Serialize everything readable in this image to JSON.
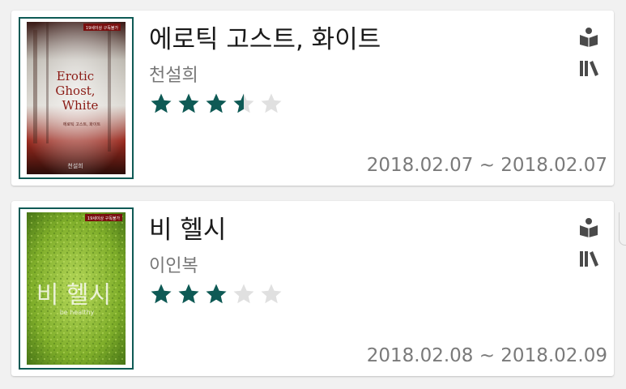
{
  "colors": {
    "accent": "#0e5a55",
    "star_filled": "#0e5a55",
    "star_empty": "#e0e0e0"
  },
  "books": [
    {
      "title": "에로틱 고스트, 화이트",
      "author": "천설희",
      "rating": 3.5,
      "rating_max": 5,
      "date_range": "2018.02.07 ~ 2018.02.07",
      "cover": {
        "title_lines": [
          "Erotic",
          "Ghost,",
          "White"
        ],
        "subtitle": "에로틱 고스트, 화이트",
        "tag": "19세이상 구독불가",
        "author_sig": "천설희"
      },
      "icons": [
        "reading-icon",
        "bookshelf-icon"
      ]
    },
    {
      "title": "비 헬시",
      "author": "이인복",
      "rating": 3,
      "rating_max": 5,
      "date_range": "2018.02.08 ~ 2018.02.09",
      "cover": {
        "title_lines": [
          "비 헬시"
        ],
        "subtitle": "be healthy",
        "tag": "19세이상 구독불가",
        "author_sig": ""
      },
      "icons": [
        "reading-icon",
        "bookshelf-icon"
      ]
    }
  ]
}
